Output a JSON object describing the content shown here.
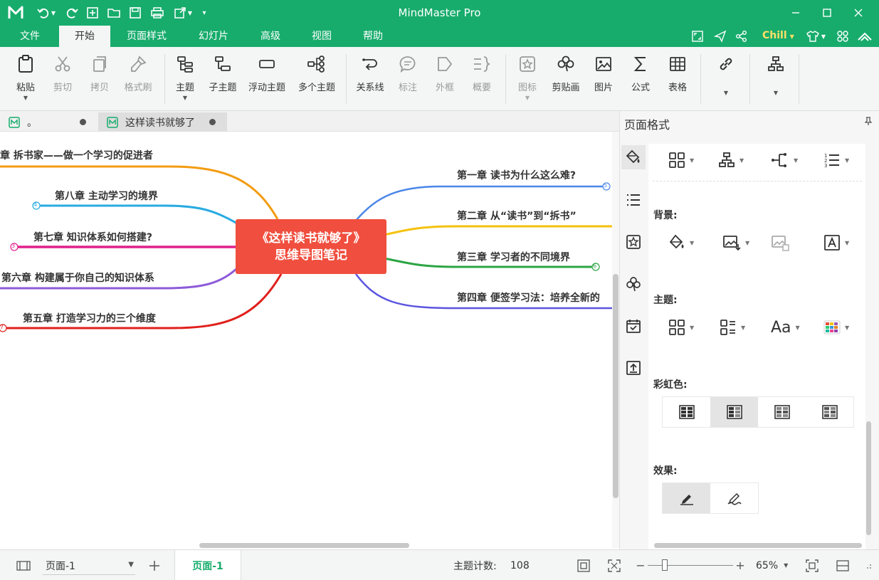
{
  "app": {
    "title": "MindMaster Pro"
  },
  "menubar": {
    "items": [
      "文件",
      "开始",
      "页面样式",
      "幻灯片",
      "高级",
      "视图",
      "帮助"
    ],
    "active": "开始",
    "user": "Chill"
  },
  "ribbon": {
    "paste": "粘贴",
    "cut": "剪切",
    "copy": "拷贝",
    "format_painter": "格式刷",
    "topic": "主题",
    "subtopic": "子主题",
    "floating_topic": "浮动主题",
    "multiple_topics": "多个主题",
    "relationship": "关系线",
    "callout": "标注",
    "boundary": "外框",
    "summary": "概要",
    "icon": "图标",
    "clipart": "剪贴画",
    "picture": "图片",
    "formula": "公式",
    "table": "表格"
  },
  "doc_tabs": [
    {
      "label": "。"
    },
    {
      "label": "这样读书就够了"
    }
  ],
  "mindmap": {
    "central": [
      "《这样读书就够了》",
      "思维导图笔记"
    ],
    "right_branches": [
      {
        "label": "第一章 读书为什么这么难?",
        "count": "5",
        "color": "#4a86e8"
      },
      {
        "label": "第二章 从“读书”到“拆书”",
        "count": "",
        "color": "#f4c20d"
      },
      {
        "label": "第三章 学习者的不同境界",
        "count": "6",
        "color": "#2ca544"
      },
      {
        "label": "第四章 便签学习法：培养全新的",
        "count": "",
        "color": "#5b55e0"
      }
    ],
    "left_branches": [
      {
        "label": "章 拆书家——做一个学习的促进者",
        "count": "",
        "color": "#f39c12"
      },
      {
        "label": "第八章 主动学习的境界",
        "count": "4",
        "color": "#29abe2"
      },
      {
        "label": "第七章 知识体系如何搭建?",
        "count": "3",
        "color": "#e0208c"
      },
      {
        "label": "第六章 构建属于你自己的知识体系",
        "count": "",
        "color": "#8e5bd9"
      },
      {
        "label": "第五章 打造学习力的三个维度",
        "count": "7",
        "color": "#e0201b"
      }
    ]
  },
  "panel": {
    "title": "页面格式",
    "background_label": "背景:",
    "theme_label": "主题:",
    "rainbow_label": "彩虹色:",
    "effect_label": "效果:"
  },
  "statusbar": {
    "page_select": "页面-1",
    "page_tab": "页面-1",
    "topic_count_label": "主题计数:",
    "topic_count": "108",
    "zoom": "65%"
  },
  "colors": {
    "brand": "#17ac6c",
    "central": "#f04e3e"
  }
}
